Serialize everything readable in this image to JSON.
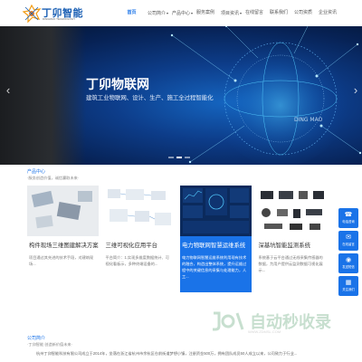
{
  "header": {
    "logo_cn": "丁卯智能",
    "logo_en": "DINGMAO TECHNOLOGY",
    "nav": [
      {
        "label": "首页",
        "active": true,
        "has_dropdown": false
      },
      {
        "label": "公司简介",
        "active": false,
        "has_dropdown": true
      },
      {
        "label": "产品中心",
        "active": false,
        "has_dropdown": true
      },
      {
        "label": "服务案例",
        "active": false,
        "has_dropdown": false
      },
      {
        "label": "项目资讯",
        "active": false,
        "has_dropdown": true
      },
      {
        "label": "在线留言",
        "active": false,
        "has_dropdown": false
      },
      {
        "label": "联系我们",
        "active": false,
        "has_dropdown": false
      },
      {
        "label": "公司资质",
        "active": false,
        "has_dropdown": false
      },
      {
        "label": "企业资讯",
        "active": false,
        "has_dropdown": false
      }
    ]
  },
  "banner": {
    "title": "丁卯物联网",
    "subtitle": "建筑工业物联网、设计、生产、施工全过程智能化",
    "globe_text": "DING MAO",
    "prev_arrow": "‹",
    "next_arrow": "›",
    "slides": 3,
    "active_slide": 1
  },
  "products": {
    "title": "产品中心",
    "subtitle": "·服务创造价值，诚信赢取未来·",
    "cards": [
      {
        "title": "构件现场三维图建解决方案",
        "desc": "项目通过其先进的技术手段，对建筑现场...",
        "featured": false,
        "dark": false
      },
      {
        "title": "三维可视化应用平台",
        "desc": "平台简介：1.实现多维度数据统计、可视化看板示，多种终端设备的...",
        "featured": false,
        "dark": false
      },
      {
        "title": "电力物联网智慧运维系统",
        "desc": "电力物联网智慧运维系统利用现有技术的融合，构造出整体系统，提升运维过程中的关键信息的采集与处理能力，人工...",
        "featured": true,
        "dark": true
      },
      {
        "title": "深基坑智能监测系统",
        "desc": "系统基于云平台通过无线采集传感器的数据，为用户提供云监测数据可视化展示...",
        "featured": false,
        "dark": false
      }
    ]
  },
  "sidebar": {
    "buttons": [
      {
        "icon": "☎",
        "label": "电话咨询"
      },
      {
        "icon": "✉",
        "label": "在线留言"
      },
      {
        "icon": "◉",
        "label": "发送短信"
      },
      {
        "icon": "▦",
        "label": "关注我们"
      }
    ]
  },
  "about": {
    "title": "公司简介",
    "subtitle": "·丁卯智能 创造新价值未来·",
    "text": "杭州丁卯智能科技有限公司成立于2014年，坐落在浙江省杭州市余杭区仓前街道梦想小镇，注册资金500万，拥有团队成员50人成立以来，公司致力于行业..."
  },
  "watermark": {
    "text": "自动秒收录",
    "sub": "WWW.ZDMSL.COM"
  },
  "colors": {
    "accent": "#1a73e8",
    "banner_dark": "#072255"
  }
}
